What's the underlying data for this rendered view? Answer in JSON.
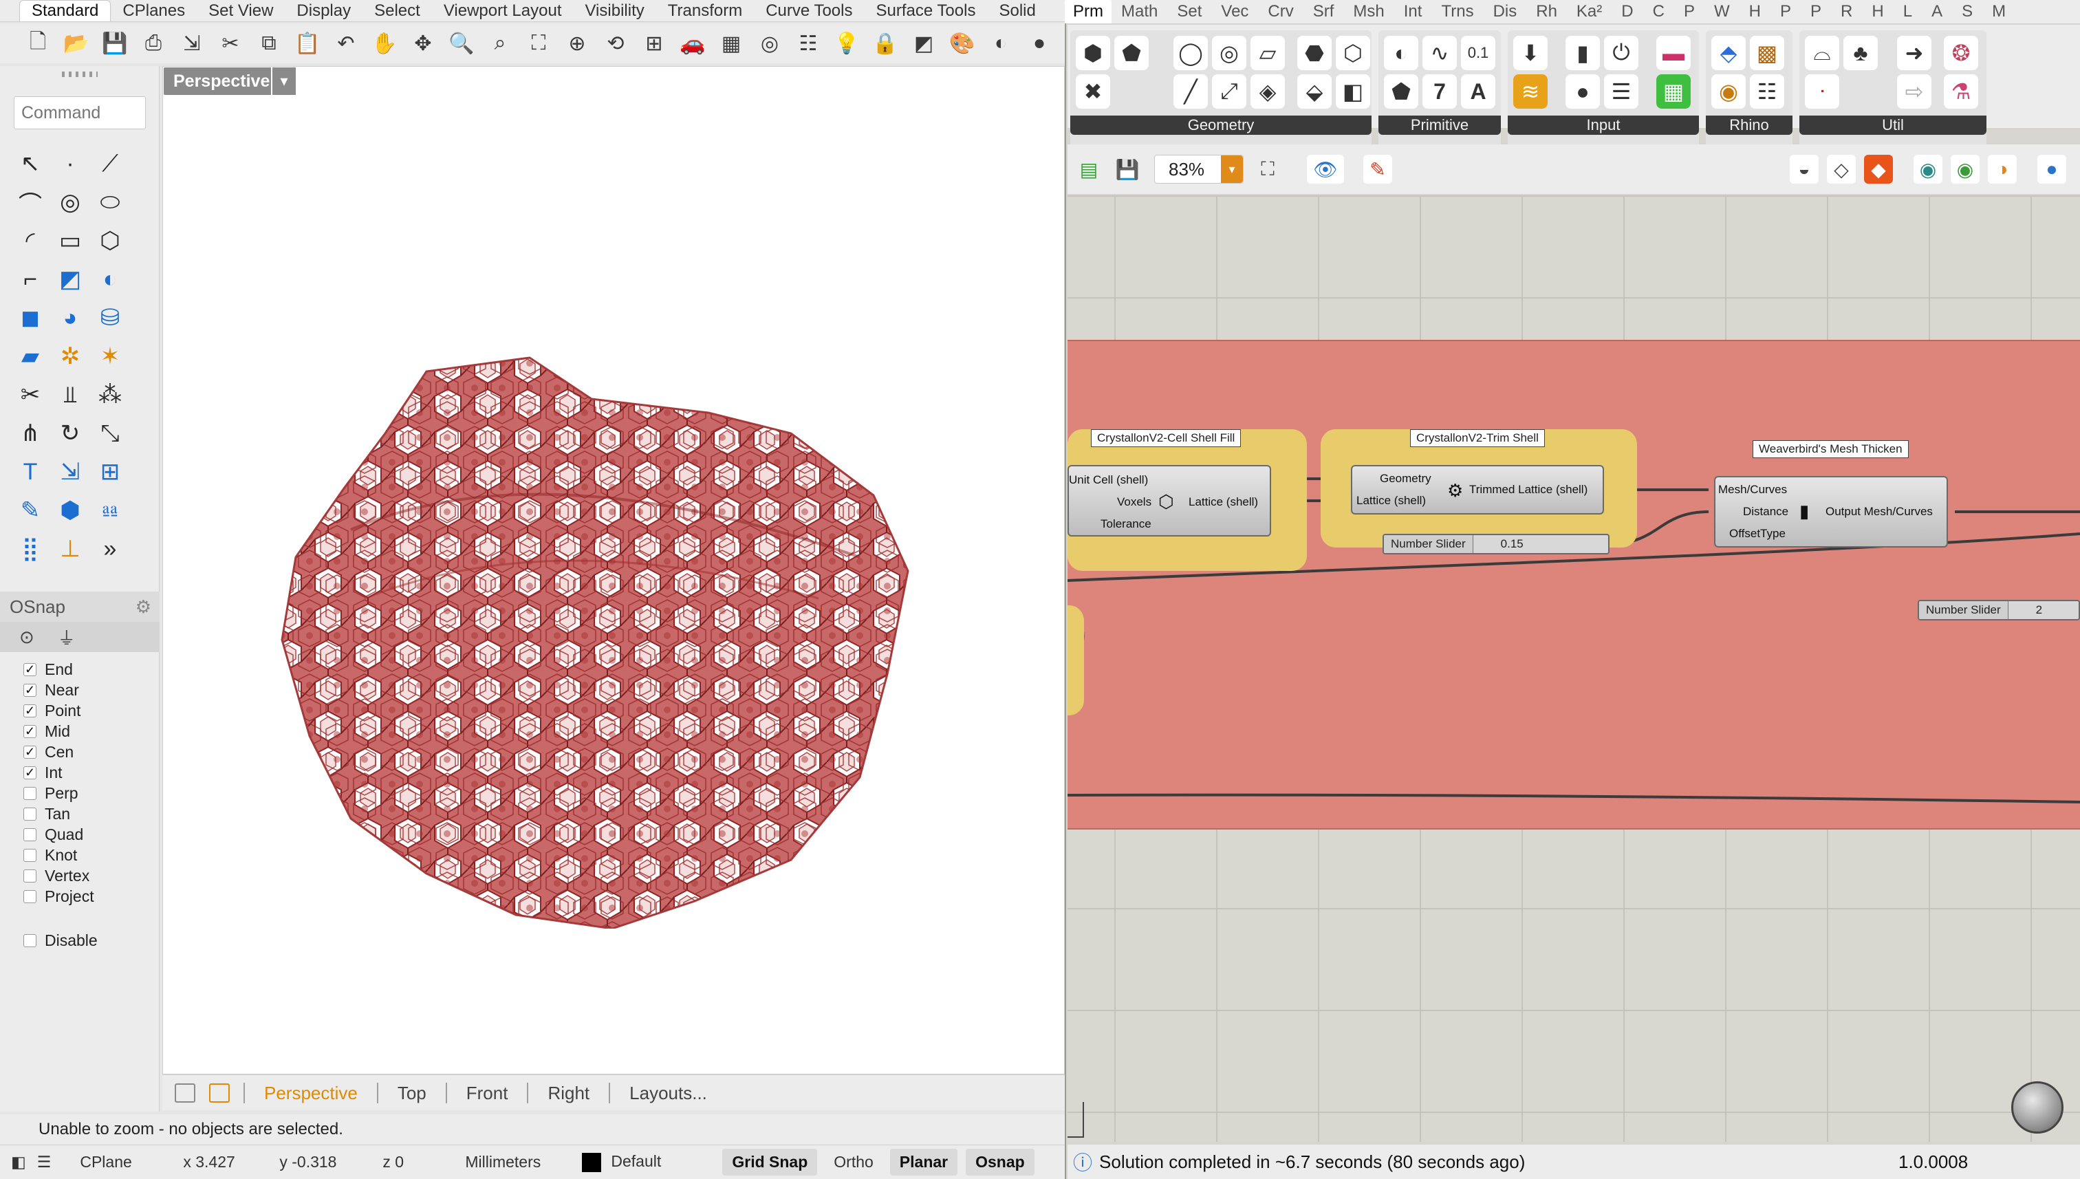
{
  "rhino": {
    "menu_tabs": [
      "Standard",
      "CPlanes",
      "Set View",
      "Display",
      "Select",
      "Viewport Layout",
      "Visibility",
      "Transform",
      "Curve Tools",
      "Surface Tools",
      "Solid"
    ],
    "active_menu_tab": "Standard",
    "toolbar_icons": [
      "new-file-icon",
      "open-folder-icon",
      "save-icon",
      "print-icon",
      "import-icon",
      "cut-icon",
      "copy-icon",
      "paste-icon",
      "undo-icon",
      "pan-icon",
      "rotate-view-icon",
      "zoom-icon",
      "zoom-window-icon",
      "zoom-extents-icon",
      "zoom-selected-icon",
      "rotate-camera-icon",
      "four-viewports-icon",
      "car-icon",
      "grid-icon",
      "circle-target-icon",
      "layers-icon",
      "bulb-icon",
      "lock-icon",
      "material-icon",
      "color-wheel-icon",
      "render-sphere-icon",
      "shaded-sphere-icon"
    ],
    "command_placeholder": "Command",
    "sidebar_tools": [
      {
        "name": "select-arrow-icon",
        "glyph": "↖",
        "tone": ""
      },
      {
        "name": "point-icon",
        "glyph": "·",
        "tone": ""
      },
      {
        "name": "polyline-icon",
        "glyph": "⟋",
        "tone": ""
      },
      {
        "name": "curve-icon",
        "glyph": "⌒",
        "tone": ""
      },
      {
        "name": "circle-icon",
        "glyph": "◎",
        "tone": ""
      },
      {
        "name": "ellipse-icon",
        "glyph": "⬭",
        "tone": ""
      },
      {
        "name": "arc-icon",
        "glyph": "◜",
        "tone": ""
      },
      {
        "name": "rectangle-icon",
        "glyph": "▭",
        "tone": ""
      },
      {
        "name": "polygon-icon",
        "glyph": "⬡",
        "tone": ""
      },
      {
        "name": "fillet-icon",
        "glyph": "⌐",
        "tone": ""
      },
      {
        "name": "surface-from-curves-icon",
        "glyph": "◩",
        "tone": "blue"
      },
      {
        "name": "loft-icon",
        "glyph": "◐",
        "tone": "blue"
      },
      {
        "name": "box-icon",
        "glyph": "◼",
        "tone": "blue"
      },
      {
        "name": "boolean-icon",
        "glyph": "◕",
        "tone": "blue"
      },
      {
        "name": "cylinder-icon",
        "glyph": "⛁",
        "tone": "blue"
      },
      {
        "name": "mesh-plane-icon",
        "glyph": "▰",
        "tone": "blue"
      },
      {
        "name": "gear-tools-icon",
        "glyph": "✲",
        "tone": "orange"
      },
      {
        "name": "explode-icon",
        "glyph": "✶",
        "tone": "orange"
      },
      {
        "name": "trim-icon",
        "glyph": "✂",
        "tone": ""
      },
      {
        "name": "split-icon",
        "glyph": "⫫",
        "tone": ""
      },
      {
        "name": "group-icon",
        "glyph": "⁂",
        "tone": ""
      },
      {
        "name": "join-icon",
        "glyph": "⋔",
        "tone": ""
      },
      {
        "name": "rotate-icon",
        "glyph": "↻",
        "tone": ""
      },
      {
        "name": "scale-icon",
        "glyph": "⤡",
        "tone": ""
      },
      {
        "name": "text-icon",
        "glyph": "T",
        "tone": "blue"
      },
      {
        "name": "dimension-icon",
        "glyph": "⇲",
        "tone": "blue"
      },
      {
        "name": "transform-icon",
        "glyph": "⊞",
        "tone": "blue"
      },
      {
        "name": "properties-icon",
        "glyph": "✎",
        "tone": "blue"
      },
      {
        "name": "analyze-icon",
        "glyph": "⬢",
        "tone": "blue"
      },
      {
        "name": "render-icon",
        "glyph": "⎂",
        "tone": "blue"
      },
      {
        "name": "array-icon",
        "glyph": "⣿",
        "tone": "blue"
      },
      {
        "name": "drafting-icon",
        "glyph": "⊥",
        "tone": "orange"
      },
      {
        "name": "more-tools-icon",
        "glyph": "»",
        "tone": ""
      }
    ],
    "osnap": {
      "title": "OSnap",
      "items": [
        {
          "label": "End",
          "checked": true
        },
        {
          "label": "Near",
          "checked": true
        },
        {
          "label": "Point",
          "checked": true
        },
        {
          "label": "Mid",
          "checked": true
        },
        {
          "label": "Cen",
          "checked": true
        },
        {
          "label": "Int",
          "checked": true
        },
        {
          "label": "Perp",
          "checked": false
        },
        {
          "label": "Tan",
          "checked": false
        },
        {
          "label": "Quad",
          "checked": false
        },
        {
          "label": "Knot",
          "checked": false
        },
        {
          "label": "Vertex",
          "checked": false
        },
        {
          "label": "Project",
          "checked": false
        }
      ],
      "disable_label": "Disable"
    },
    "viewport_label": "Perspective",
    "view_tabs": [
      "Perspective",
      "Top",
      "Front",
      "Right",
      "Layouts..."
    ],
    "status_message": "Unable to zoom - no objects are selected.",
    "statusbar": {
      "cplane": "CPlane",
      "x": "x 3.427",
      "y": "y -0.318",
      "z": "z 0",
      "units": "Millimeters",
      "layer": "Default",
      "grid_snap": "Grid Snap",
      "ortho": "Ortho",
      "planar": "Planar",
      "osnap": "Osnap"
    }
  },
  "grasshopper": {
    "tabs": [
      "Prm",
      "Math",
      "Set",
      "Vec",
      "Crv",
      "Srf",
      "Msh",
      "Int",
      "Trns",
      "Dis",
      "Rh",
      "Ka²",
      "D",
      "C",
      "P",
      "W",
      "H",
      "P",
      "P",
      "R",
      "H",
      "L",
      "A",
      "S",
      "M"
    ],
    "active_tab": "Prm",
    "ribbon_groups": [
      "Geometry",
      "Primitive",
      "Input",
      "Rhino",
      "Util"
    ],
    "zoom": "83%",
    "components": {
      "cell_shell_fill": {
        "title": "CrystallonV2-Cell Shell Fill",
        "inputs": [
          "Unit Cell (shell)",
          "Voxels",
          "Tolerance"
        ],
        "output": "Lattice (shell)"
      },
      "trim_shell": {
        "title": "CrystallonV2-Trim Shell",
        "inputs": [
          "Geometry",
          "Lattice (shell)"
        ],
        "output": "Trimmed Lattice (shell)"
      },
      "mesh_thicken": {
        "title": "Weaverbird's Mesh Thicken",
        "inputs": [
          "Mesh/Curves",
          "Distance",
          "OffsetType"
        ],
        "output": "Output Mesh/Curves"
      }
    },
    "sliders": [
      {
        "label": "Number Slider",
        "value": "0.15"
      },
      {
        "label": "Number Slider",
        "value": "2"
      }
    ],
    "status": "Solution completed in ~6.7 seconds (80 seconds ago)",
    "version": "1.0.0008"
  }
}
